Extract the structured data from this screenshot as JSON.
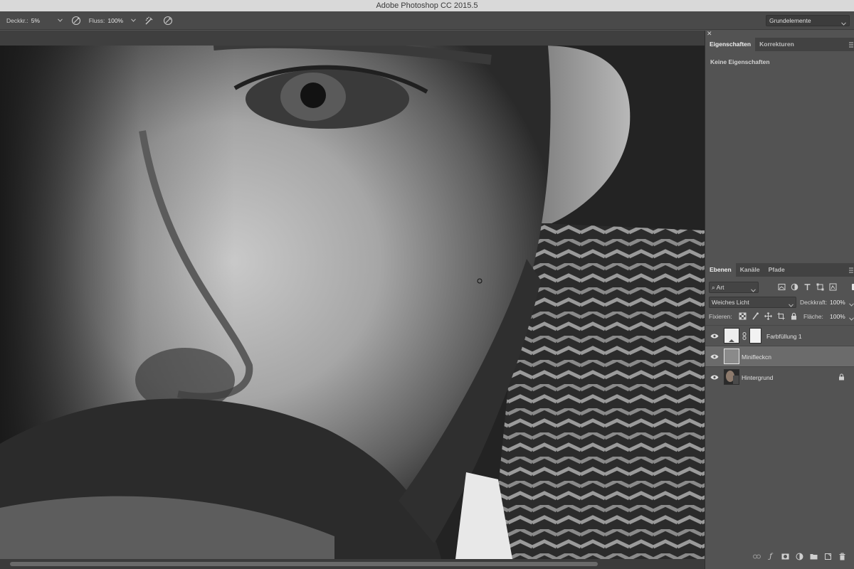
{
  "app": {
    "title": "Adobe Photoshop CC 2015.5"
  },
  "options": {
    "opacity_label": "Deckkr.:",
    "opacity_value": "5%",
    "flow_label": "Fluss:",
    "flow_value": "100%",
    "workspace": "Grundelemente"
  },
  "properties_panel": {
    "tabs": [
      "Eigenschaften",
      "Korrekturen"
    ],
    "empty_text": "Keine Eigenschaften"
  },
  "layers_panel": {
    "tabs": [
      "Ebenen",
      "Kanäle",
      "Pfade"
    ],
    "filter_kind": "Art",
    "blend_mode": "Weiches Licht",
    "opacity_label": "Deckkraft:",
    "opacity_value": "100%",
    "lock_label": "Fixieren:",
    "fill_label": "Fläche:",
    "fill_value": "100%",
    "layers": [
      {
        "name": "Farbfüllung 1",
        "visible": true,
        "selected": false,
        "locked": false
      },
      {
        "name": "Minifleckcn",
        "visible": true,
        "selected": true,
        "locked": false
      },
      {
        "name": "Hintergrund",
        "visible": true,
        "selected": false,
        "locked": true
      }
    ]
  },
  "colors": {
    "panel_bg": "#535353",
    "selected_layer": "#6b6b6b",
    "titlebar": "#d9d9d9"
  }
}
